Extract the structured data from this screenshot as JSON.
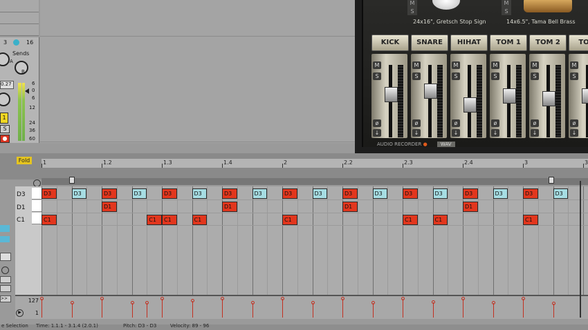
{
  "mixer": {
    "track_num": "3",
    "track_count": "16",
    "sends_label": "Sends",
    "send_a": "A",
    "send_b": "B",
    "volume": "0.27",
    "db_scale": [
      "6",
      "0",
      "6",
      "12",
      "24",
      "36",
      "60"
    ],
    "track_button": "1",
    "solo": "S",
    "arm": "●"
  },
  "plugin": {
    "drum_captions": [
      "24x16\", Gretsch Stop Sign",
      "14x6.5\", Tama Bell Brass"
    ],
    "mute_small": "M",
    "solo_small": "S",
    "channels": [
      {
        "name": "KICK",
        "level": 0.62
      },
      {
        "name": "SNARE",
        "level": 0.68
      },
      {
        "name": "HIHAT",
        "level": 0.45
      },
      {
        "name": "TOM 1",
        "level": 0.6
      },
      {
        "name": "TOM 2",
        "level": 0.55
      },
      {
        "name": "TOM",
        "level": 0.6
      }
    ],
    "channel_mute": "M",
    "channel_solo": "S",
    "recorder_label": "AUDIO RECORDER",
    "wav_label": "WAV"
  },
  "editor": {
    "fold_label": "Fold",
    "ruler": [
      "1",
      "1.2",
      "1.3",
      "1.4",
      "2",
      "2.2",
      "2.3",
      "2.4",
      "3",
      "3."
    ],
    "pitches": [
      "D3",
      "D1",
      "C1"
    ],
    "velocity_max": "127",
    "velocity_min": "1",
    "notes": [
      {
        "pitch": "D3",
        "start": 0,
        "len": 0.5,
        "color": "red"
      },
      {
        "pitch": "D3",
        "start": 1,
        "len": 0.5,
        "color": "cyan"
      },
      {
        "pitch": "D3",
        "start": 2,
        "len": 0.5,
        "color": "red"
      },
      {
        "pitch": "D3",
        "start": 3,
        "len": 0.5,
        "color": "cyan"
      },
      {
        "pitch": "D3",
        "start": 4,
        "len": 0.5,
        "color": "red"
      },
      {
        "pitch": "D3",
        "start": 5,
        "len": 0.5,
        "color": "cyan"
      },
      {
        "pitch": "D3",
        "start": 6,
        "len": 0.5,
        "color": "red"
      },
      {
        "pitch": "D3",
        "start": 7,
        "len": 0.5,
        "color": "cyan"
      },
      {
        "pitch": "D3",
        "start": 8,
        "len": 0.5,
        "color": "red"
      },
      {
        "pitch": "D3",
        "start": 9,
        "len": 0.5,
        "color": "cyan"
      },
      {
        "pitch": "D3",
        "start": 10,
        "len": 0.5,
        "color": "red"
      },
      {
        "pitch": "D3",
        "start": 11,
        "len": 0.5,
        "color": "cyan"
      },
      {
        "pitch": "D3",
        "start": 12,
        "len": 0.5,
        "color": "red"
      },
      {
        "pitch": "D3",
        "start": 13,
        "len": 0.5,
        "color": "cyan"
      },
      {
        "pitch": "D3",
        "start": 14,
        "len": 0.5,
        "color": "red"
      },
      {
        "pitch": "D3",
        "start": 15,
        "len": 0.5,
        "color": "cyan"
      },
      {
        "pitch": "D3",
        "start": 16,
        "len": 0.5,
        "color": "red"
      },
      {
        "pitch": "D3",
        "start": 17,
        "len": 0.5,
        "color": "cyan"
      },
      {
        "pitch": "D1",
        "start": 2,
        "len": 0.5,
        "color": "red"
      },
      {
        "pitch": "D1",
        "start": 6,
        "len": 0.5,
        "color": "red"
      },
      {
        "pitch": "D1",
        "start": 10,
        "len": 0.5,
        "color": "red"
      },
      {
        "pitch": "D1",
        "start": 14,
        "len": 0.5,
        "color": "red"
      },
      {
        "pitch": "C1",
        "start": 0,
        "len": 0.5,
        "color": "red"
      },
      {
        "pitch": "C1",
        "start": 3.5,
        "len": 0.5,
        "color": "red"
      },
      {
        "pitch": "C1",
        "start": 4,
        "len": 0.5,
        "color": "red"
      },
      {
        "pitch": "C1",
        "start": 5,
        "len": 0.5,
        "color": "red"
      },
      {
        "pitch": "C1",
        "start": 8,
        "len": 0.5,
        "color": "red"
      },
      {
        "pitch": "C1",
        "start": 12,
        "len": 0.5,
        "color": "red"
      },
      {
        "pitch": "C1",
        "start": 13,
        "len": 0.5,
        "color": "red"
      },
      {
        "pitch": "C1",
        "start": 16,
        "len": 0.5,
        "color": "red"
      }
    ],
    "velocity_stems": [
      {
        "beat": 0,
        "value": 0.95
      },
      {
        "beat": 1,
        "value": 0.75
      },
      {
        "beat": 2,
        "value": 0.95
      },
      {
        "beat": 3,
        "value": 0.75
      },
      {
        "beat": 3.5,
        "value": 0.75
      },
      {
        "beat": 4,
        "value": 0.95
      },
      {
        "beat": 5,
        "value": 0.85
      },
      {
        "beat": 6,
        "value": 0.95
      },
      {
        "beat": 7,
        "value": 0.75
      },
      {
        "beat": 8,
        "value": 0.95
      },
      {
        "beat": 9,
        "value": 0.75
      },
      {
        "beat": 10,
        "value": 0.95
      },
      {
        "beat": 11,
        "value": 0.75
      },
      {
        "beat": 12,
        "value": 0.95
      },
      {
        "beat": 13,
        "value": 0.8
      },
      {
        "beat": 14,
        "value": 0.95
      },
      {
        "beat": 15,
        "value": 0.75
      },
      {
        "beat": 16,
        "value": 0.95
      },
      {
        "beat": 17,
        "value": 0.72
      }
    ]
  },
  "status": {
    "selection": "e Selection",
    "time": "Time: 1.1.1 - 3.1.4 (2.0.1)",
    "pitch": "Pitch: D3 - D3",
    "velocity": "Velocity: 89 - 96"
  },
  "colors": {
    "note_red": "#e2361d",
    "note_cyan": "#a6dde3",
    "fold": "#e6c51f"
  }
}
